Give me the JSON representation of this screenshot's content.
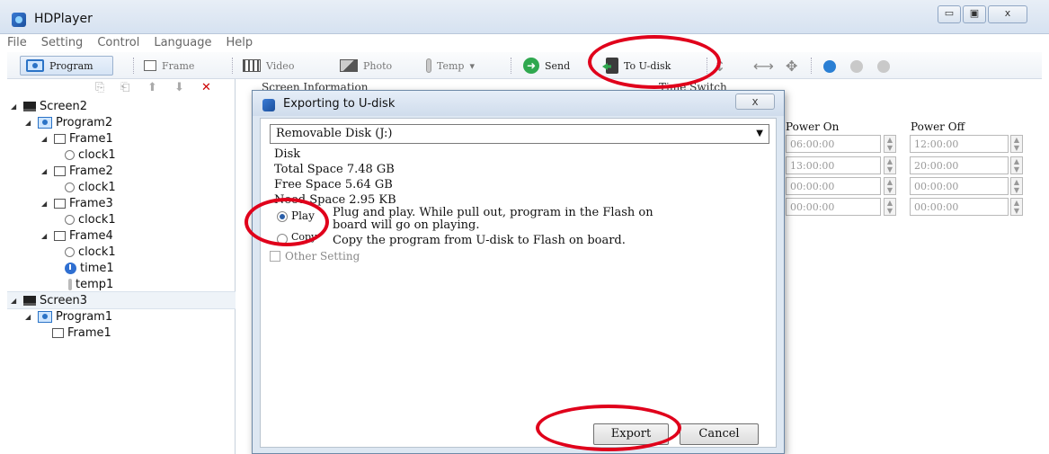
{
  "window": {
    "title": "HDPlayer",
    "minimize_glyph": "▭",
    "restore_glyph": "▣",
    "close_glyph": "ⅹ"
  },
  "menu": [
    "File",
    "Setting",
    "Control",
    "Language",
    "Help"
  ],
  "toolbar": {
    "program": "Program",
    "frame": "Frame",
    "video": "Video",
    "photo": "Photo",
    "temp": "Temp",
    "temp_caret": "▾",
    "send": "Send",
    "to_udisk": "To U-disk"
  },
  "tree": {
    "screen2": "Screen2",
    "program2": "Program2",
    "frame1": "Frame1",
    "clock1": "clock1",
    "frame2": "Frame2",
    "frame3": "Frame3",
    "frame4": "Frame4",
    "time1": "time1",
    "temp1": "temp1",
    "screen3": "Screen3",
    "program1": "Program1"
  },
  "background": {
    "screen_information": "Screen Information",
    "time_switch": "Time Switch",
    "power_on": "Power On",
    "power_off": "Power Off",
    "rows": [
      {
        "on": "06:00:00",
        "off": "12:00:00"
      },
      {
        "on": "13:00:00",
        "off": "20:00:00"
      },
      {
        "on": "00:00:00",
        "off": "00:00:00"
      },
      {
        "on": "00:00:00",
        "off": "00:00:00"
      }
    ]
  },
  "dialog": {
    "title": "Exporting to U-disk",
    "close": "ⅹ",
    "drive": "Removable Disk (J:)",
    "disk_label": "Disk",
    "total_space": "Total Space 7.48 GB",
    "free_space": "Free Space  5.64 GB",
    "need_space": "Need Space  2.95 KB",
    "play_label": "Play",
    "play_desc_1": "Plug and play. While pull out, program in the Flash on",
    "play_desc_2": "board will go on playing.",
    "copy_label": "Copy",
    "copy_desc": "Copy the program from U-disk to Flash on board.",
    "other_setting": "Other Setting",
    "export": "Export",
    "cancel": "Cancel"
  },
  "colors": {
    "annotation": "#e0001b",
    "accent": "#2b73c6"
  }
}
